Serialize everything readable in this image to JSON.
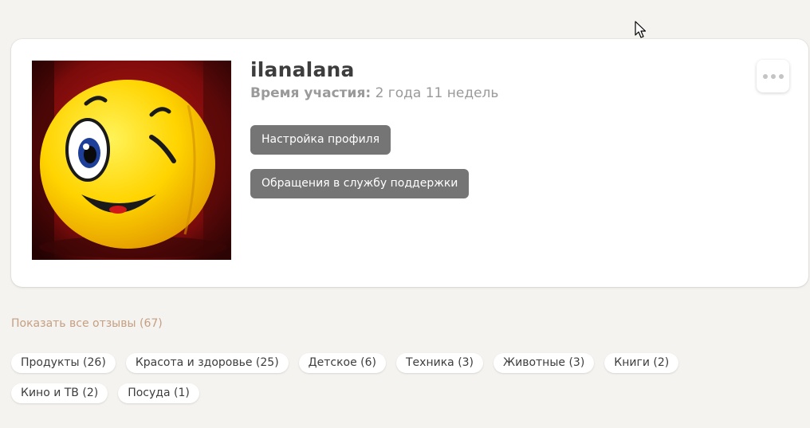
{
  "profile": {
    "username": "ilanalana",
    "membership_label": "Время участия:",
    "membership_value": "2 года 11 недель",
    "avatar": "winking-smiley-ball"
  },
  "actions": {
    "settings": "Настройка профиля",
    "support": "Обращения в службу поддержки",
    "more_icon": "more-dots-icon"
  },
  "reviews": {
    "show_all": "Показать все отзывы (67)"
  },
  "tags": [
    "Продукты (26)",
    "Красота и здоровье (25)",
    "Детское (6)",
    "Техника (3)",
    "Животные (3)",
    "Книги (2)",
    "Кино и ТВ (2)",
    "Посуда (1)"
  ],
  "colors": {
    "background": "#f5f3ef",
    "card": "#ffffff",
    "button": "#757575",
    "link": "#c49f84",
    "avatar_face": "#ffd400",
    "avatar_background": "#a01818"
  }
}
